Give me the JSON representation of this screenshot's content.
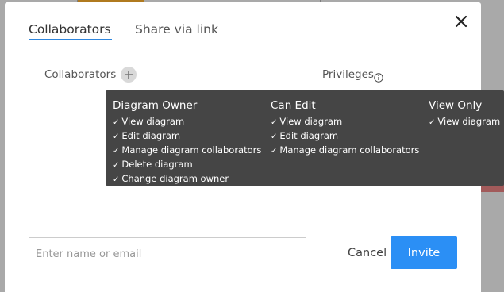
{
  "dialog": {
    "tabs": [
      {
        "label": "Collaborators",
        "active": true
      },
      {
        "label": "Share via link",
        "active": false
      }
    ],
    "close_icon": "close-icon",
    "collaborators_label": "Collaborators",
    "add_icon": "plus-icon",
    "privileges_label": "Privileges",
    "info_icon": "info-icon",
    "invite_input": {
      "placeholder": "Enter name or email",
      "value": ""
    },
    "cancel_label": "Cancel",
    "invite_label": "Invite"
  },
  "tooltip": {
    "columns": [
      {
        "title": "Diagram Owner",
        "items": [
          "View diagram",
          "Edit diagram",
          "Manage diagram collaborators",
          "Delete diagram",
          "Change diagram owner"
        ]
      },
      {
        "title": "Can Edit",
        "items": [
          "View diagram",
          "Edit diagram",
          "Manage diagram collaborators"
        ]
      },
      {
        "title": "View Only",
        "items": [
          "View diagram"
        ]
      }
    ]
  },
  "colors": {
    "accent": "#2b8ff5",
    "tab_underline": "#2e86de",
    "tooltip_bg": "#454545",
    "overlay_bg": "#a9a9a9"
  }
}
